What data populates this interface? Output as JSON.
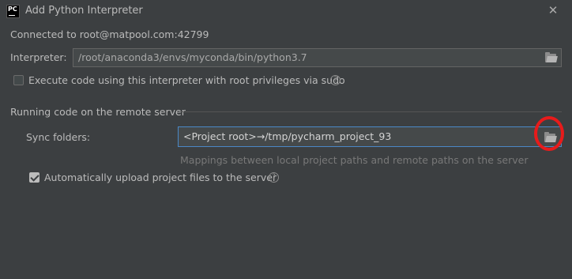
{
  "window": {
    "title": "Add Python Interpreter",
    "logo_text": "PC"
  },
  "connection": {
    "text": "Connected to root@matpool.com:42799"
  },
  "interpreter": {
    "label": "Interpreter:",
    "value": "/root/anaconda3/envs/myconda/bin/python3.7"
  },
  "sudo": {
    "label": "Execute code using this interpreter with root privileges via sudo",
    "checked": false
  },
  "section": {
    "title": "Running code on the remote server"
  },
  "sync": {
    "label": "Sync folders:",
    "value": "<Project root>→/tmp/pycharm_project_93",
    "hint": "Mappings between local project paths and remote paths on the server"
  },
  "upload": {
    "label": "Automatically upload project files to the server",
    "checked": true
  },
  "icons": {
    "close": "close-icon",
    "folder": "folder-icon",
    "help": "help-icon"
  },
  "colors": {
    "background": "#3c3f41",
    "focus_border": "#4a88c7",
    "annotation": "#e81b1b"
  }
}
